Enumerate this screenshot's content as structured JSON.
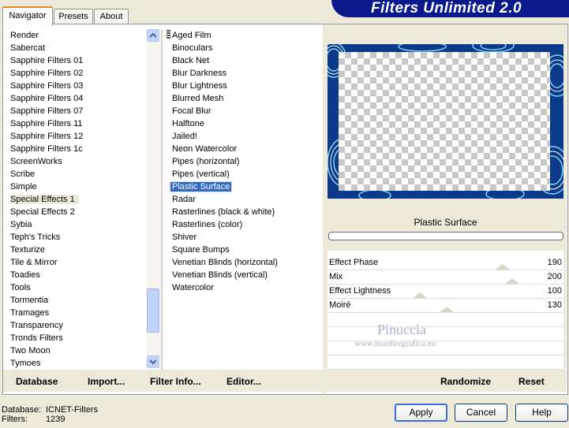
{
  "tabs": [
    "Navigator",
    "Presets",
    "About"
  ],
  "banner_title": "Filters Unlimited 2.0",
  "categories": {
    "items": [
      "Render",
      "Sabercat",
      "Sapphire Filters 01",
      "Sapphire Filters 02",
      "Sapphire Filters 03",
      "Sapphire Filters 04",
      "Sapphire Filters 07",
      "Sapphire Filters 11",
      "Sapphire Filters 12",
      "Sapphire Filters 1c",
      "ScreenWorks",
      "Scribe",
      "Simple",
      "Special Effects 1",
      "Special Effects 2",
      "Sybia",
      "Teph's Tricks",
      "Texturize",
      "Tile & Mirror",
      "Toadies",
      "Tools",
      "Tormentia",
      "Tramages",
      "Transparency",
      "Tronds Filters",
      "Two Moon",
      "Tymoes"
    ],
    "selected": "Special Effects 1"
  },
  "filters": {
    "items": [
      "Aged Film",
      "Binoculars",
      "Black Net",
      "Blur Darkness",
      "Blur Lightness",
      "Blurred Mesh",
      "Focal Blur",
      "Halftone",
      "Jailed!",
      "Neon Watercolor",
      "Pipes (horizontal)",
      "Pipes (vertical)",
      "Plastic Surface",
      "Radar",
      "Rasterlines (black & white)",
      "Rasterlines (color)",
      "Shiver",
      "Square Bumps",
      "Venetian Blinds (horizontal)",
      "Venetian Blinds (vertical)",
      "Watercolor"
    ],
    "selected": "Plastic Surface"
  },
  "links": {
    "database": "Database",
    "import": "Import...",
    "filter_info": "Filter Info...",
    "editor": "Editor...",
    "randomize": "Randomize",
    "reset": "Reset"
  },
  "preview": {
    "filter_name": "Plastic Surface"
  },
  "params": [
    {
      "label": "Effect Phase",
      "value": "190"
    },
    {
      "label": "Mix",
      "value": "200"
    },
    {
      "label": "Effect Lightness",
      "value": "100"
    },
    {
      "label": "Moiré",
      "value": "130"
    }
  ],
  "watermark": {
    "name": "Pinuccia",
    "site": "www.maidiregrafica.eu"
  },
  "footer": {
    "database_label": "Database:",
    "database_value": "ICNET-Filters",
    "filters_label": "Filters:",
    "filters_value": "1239"
  },
  "buttons": {
    "apply": "Apply",
    "cancel": "Cancel",
    "help": "Help"
  },
  "colors": {
    "banner": "#0a1a8c",
    "selection": "#316ac5",
    "window_bg": "#ece9d8"
  }
}
